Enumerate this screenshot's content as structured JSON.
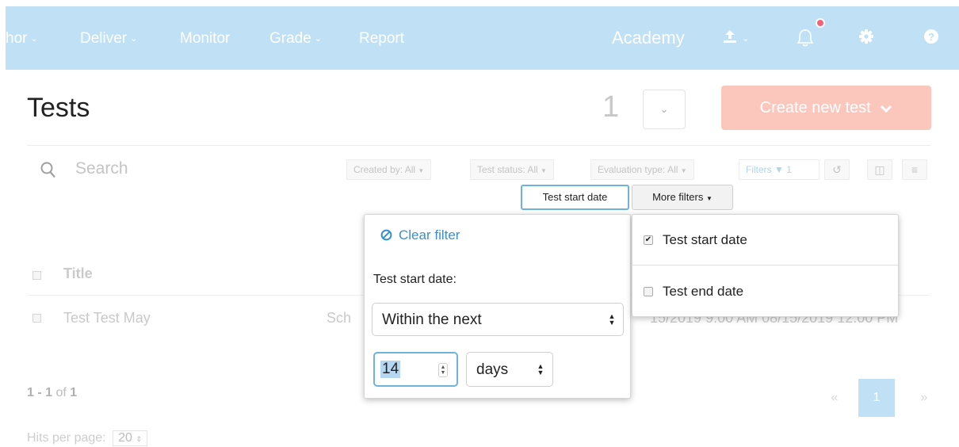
{
  "nav": {
    "items": [
      {
        "label": "hor",
        "has_caret": true
      },
      {
        "label": "Deliver",
        "has_caret": true
      },
      {
        "label": "Monitor",
        "has_caret": false
      },
      {
        "label": "Grade",
        "has_caret": true
      },
      {
        "label": "Report",
        "has_caret": false
      }
    ],
    "org": "Academy",
    "icons": [
      "upload-icon",
      "bell-icon",
      "gear-icon",
      "help-icon"
    ]
  },
  "header": {
    "title": "Tests",
    "count": "1",
    "create_button": "Create new test"
  },
  "search": {
    "placeholder": "Search"
  },
  "filters": {
    "created_by": "Created by: All",
    "test_status": "Test status: All",
    "evaluation_type": "Evaluation type: All",
    "filters_label": "Filters",
    "filters_count": "1",
    "test_start_date": "Test start date",
    "more_filters": "More filters"
  },
  "table": {
    "header_title": "Title",
    "rows": [
      {
        "title": "Test Test May",
        "schedule_fragment": "Sch",
        "dates_fragment": "15/2019 9:00 AM   08/15/2019 12:00 PM"
      }
    ]
  },
  "pagination": {
    "range_start": "1",
    "range_end": "1",
    "of_label": "of",
    "total": "1",
    "hits_label": "Hits per page:",
    "hits_value": "20",
    "prev": "«",
    "current": "1",
    "next": "»"
  },
  "date_popover": {
    "clear_filter": "Clear filter",
    "label": "Test start date:",
    "range_option": "Within the next",
    "amount": "14",
    "unit": "days"
  },
  "more_filters_menu": {
    "items": [
      {
        "label": "Test start date",
        "checked": true
      },
      {
        "label": "Test end date",
        "checked": false
      }
    ]
  },
  "colors": {
    "nav_bg": "#bfe0f5",
    "accent": "#3a90c8",
    "create_button_bg": "#fbc7bd",
    "notification_dot": "#f2637a"
  }
}
